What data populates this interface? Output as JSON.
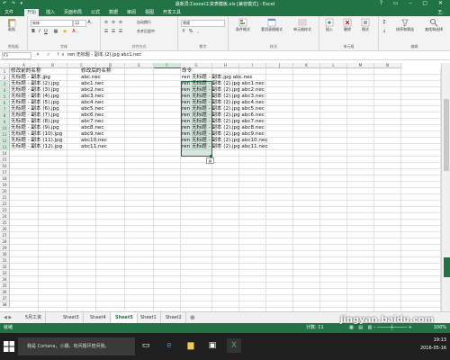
{
  "window": {
    "title": "最新员工excel工资表模板.xls [兼容模式] - Excel",
    "quick_access": "↶ ↷ ▾",
    "controls": "? ▭ – ▢ ✕"
  },
  "tabs": [
    "文件",
    "开始",
    "插入",
    "页面布局",
    "公式",
    "数据",
    "审阅",
    "视图",
    "开发工具"
  ],
  "user": "王.",
  "ribbon": {
    "paste": "粘贴",
    "font_name": "宋体",
    "font_size": "12",
    "wrap_text": "自动换行",
    "merge": "合并后居中",
    "number_format": "常规",
    "cond_format": "条件格式",
    "table_format": "套用表格格式",
    "cell_style": "单元格样式",
    "insert": "插入",
    "delete": "删除",
    "format": "格式",
    "sort_filter": "排序和筛选",
    "find_select": "查找和选择",
    "groups": [
      "剪贴板",
      "字体",
      "对齐方式",
      "数字",
      "样式",
      "单元格",
      "编辑"
    ]
  },
  "formula_bar": {
    "name_box": "F3",
    "fx": "✕ ✓ fx",
    "formula": "ren 无标题 - 副本 (2).jpg abc1.nec"
  },
  "columns": [
    "A",
    "B",
    "C",
    "D",
    "E",
    "F",
    "G",
    "H",
    "I",
    "J",
    "K",
    "L",
    "M",
    "N"
  ],
  "rows": [
    "1",
    "2",
    "3",
    "4",
    "5",
    "6",
    "7",
    "8",
    "9",
    "10",
    "11",
    "12",
    "13",
    "14",
    "15",
    "16",
    "17",
    "18",
    "19",
    "20",
    "21",
    "22",
    "23",
    "24",
    "25",
    "26",
    "27",
    "28",
    "29",
    "30",
    "31",
    "32",
    "33",
    "34",
    "35",
    "36",
    "37",
    "38"
  ],
  "sheet": {
    "headers": {
      "col_a": "修改前的名称",
      "col_c": "修改后的名称",
      "col_e": "命令"
    },
    "rows": [
      {
        "a": "无标题 - 副本.jpg",
        "c": "abc.nec",
        "e": "ren 无标题 - 副本.jpg abc.nec"
      },
      {
        "a": "无标题 - 副本 (2).jpg",
        "c": "abc1.nec",
        "e": "ren 无标题 - 副本 (2).jpg abc1.nec"
      },
      {
        "a": "无标题 - 副本 (3).jpg",
        "c": "abc2.nec",
        "e": "ren 无标题 - 副本 (2).jpg abc2.nec"
      },
      {
        "a": "无标题 - 副本 (4).jpg",
        "c": "abc3.nec",
        "e": "ren 无标题 - 副本 (2).jpg abc3.nec"
      },
      {
        "a": "无标题 - 副本 (5).jpg",
        "c": "abc4.nec",
        "e": "ren 无标题 - 副本 (2).jpg abc4.nec"
      },
      {
        "a": "无标题 - 副本 (6).jpg",
        "c": "abc5.nec",
        "e": "ren 无标题 - 副本 (2).jpg abc5.nec"
      },
      {
        "a": "无标题 - 副本 (7).jpg",
        "c": "abc6.nec",
        "e": "ren 无标题 - 副本 (2).jpg abc6.nec"
      },
      {
        "a": "无标题 - 副本 (8).jpg",
        "c": "abc7.nec",
        "e": "ren 无标题 - 副本 (2).jpg abc7.nec"
      },
      {
        "a": "无标题 - 副本 (9).jpg",
        "c": "abc8.nec",
        "e": "ren 无标题 - 副本 (2).jpg abc8.nec"
      },
      {
        "a": "无标题 - 副本 (10).jpg",
        "c": "abc9.nec",
        "e": "ren 无标题 - 副本 (2).jpg abc9.nec"
      },
      {
        "a": "无标题 - 副本 (11).jpg",
        "c": "abc10.nec",
        "e": "ren 无标题 - 副本 (2).jpg abc10.nec"
      },
      {
        "a": "无标题 - 副本 (12).jpg",
        "c": "abc11.nec",
        "e": "ren 无标题 - 副本 (2).jpg abc11.nec"
      }
    ]
  },
  "sheet_tabs": {
    "nav": "◀ ▶",
    "tabs": [
      "5月工资",
      "Sheet3",
      "Sheet4",
      "Sheet5",
      "Sheet1",
      "Sheet2"
    ],
    "active": "Sheet5",
    "add": "⊕"
  },
  "status_bar": {
    "left": "就绪",
    "count": "计数: 11",
    "zoom": "100%"
  },
  "taskbar": {
    "search_placeholder": "我是 Cortana，小娜。有问题尽管问我。",
    "time": "19:13",
    "date": "2016-05-16"
  },
  "watermark": "jingyan.baidu.com",
  "colors": {
    "accent": "#217346",
    "selection": "#d3e7db"
  }
}
